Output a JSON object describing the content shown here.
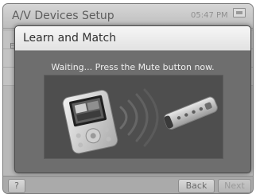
{
  "app": {
    "title": "A/V Devices Setup",
    "time": "05:47 PM",
    "status_icon": "battery-icon"
  },
  "background": {
    "row_letter": "E"
  },
  "dialog": {
    "title": "Learn and Match",
    "message": "Waiting... Press the Mute button now.",
    "illustration": {
      "device_icon": "handheld-controller-icon",
      "remote_icon": "ir-remote-icon",
      "signal_icon": "infrared-signal-icon"
    }
  },
  "footer": {
    "help_label": "?",
    "back_label": "Back",
    "next_label": "Next"
  },
  "colors": {
    "dialog_bg": "#6e6e6e",
    "header_bg": "#ececec",
    "screen_bg": "#b9b9b9"
  }
}
